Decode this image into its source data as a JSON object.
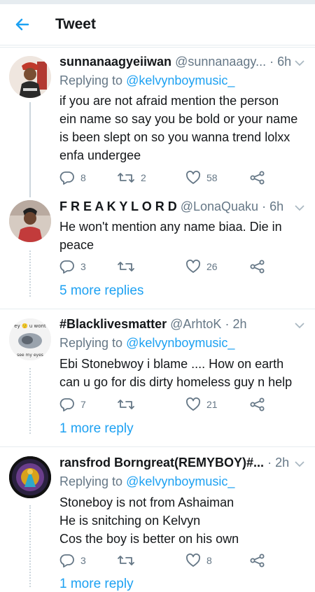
{
  "header": {
    "title": "Tweet"
  },
  "colors": {
    "accent": "#1da1f2",
    "muted": "#657786",
    "text": "#14171a",
    "divider": "#e6ecf0"
  },
  "tweets": [
    {
      "display_name": "sunnanaagyeiiwan",
      "handle": "@sunnanaagy...",
      "dot": "·",
      "time": "6h",
      "replying_prefix": "Replying to",
      "replying_to": "@kelvynboymusic_",
      "text_lines": [
        "if you are not afraid mention the person",
        "ein name so say you be bold or your name",
        "is been slept on so you wanna trend lolxx",
        "enfa undergee"
      ],
      "replies": "8",
      "retweets": "2",
      "likes": "58"
    },
    {
      "display_name": "F R E A K Y L O R D",
      "handle": "@LonaQuaku",
      "dot": "·",
      "time": "6h",
      "text_lines": [
        "He won't mention any name biaa. Die in",
        "peace"
      ],
      "replies": "3",
      "retweets": "",
      "likes": "26",
      "more_replies": "5 more replies"
    },
    {
      "display_name": "#Blacklivesmatter",
      "handle": "@ArhtoK",
      "dot": "·",
      "time": "2h",
      "replying_prefix": "Replying to",
      "replying_to": "@kelvynboymusic_",
      "text_lines": [
        "Ebi Stonebwoy i blame .... How on earth",
        "can u go for dis dirty homeless guy n help"
      ],
      "replies": "7",
      "retweets": "",
      "likes": "21",
      "more_replies": "1 more reply",
      "avatar_caption_top": "ey 🙂 u wont",
      "avatar_caption_bottom": "• see my eyes •"
    },
    {
      "display_name": "ransfrod Borngreat(REMYBOY)#...",
      "handle": "",
      "dot": "·",
      "time": "2h",
      "replying_prefix": "Replying to",
      "replying_to": "@kelvynboymusic_",
      "text_lines": [
        "Stoneboy is not from Ashaiman",
        "He is snitching on Kelvyn",
        "Cos the boy is better on his own"
      ],
      "replies": "3",
      "retweets": "",
      "likes": "8",
      "more_replies": "1 more reply"
    }
  ]
}
